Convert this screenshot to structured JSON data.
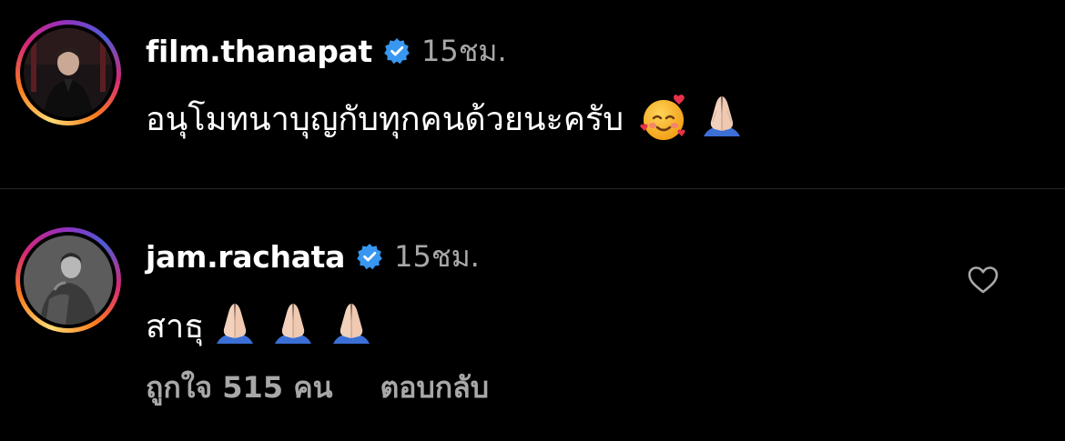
{
  "comments": [
    {
      "username": "film.thanapat",
      "verified": true,
      "time": "15ชม.",
      "text": "อนุโมทนาบุญกับทุกคนด้วยนะครับ",
      "emojis": [
        "smiling-face-with-hearts",
        "folded-hands"
      ],
      "avatar_icon": "profile-photo"
    },
    {
      "username": "jam.rachata",
      "verified": true,
      "time": "15ชม.",
      "text": "สาธุ",
      "emojis": [
        "folded-hands",
        "folded-hands",
        "folded-hands"
      ],
      "avatar_icon": "profile-photo",
      "likes_label": "ถูกใจ 515 คน",
      "reply_label": "ตอบกลับ",
      "like_icon": "heart-outline-icon"
    }
  ],
  "colors": {
    "background": "#000000",
    "primary_text": "#ffffff",
    "secondary_text": "#a8a8a8",
    "verified_badge": "#3897f0",
    "divider": "#262626"
  }
}
